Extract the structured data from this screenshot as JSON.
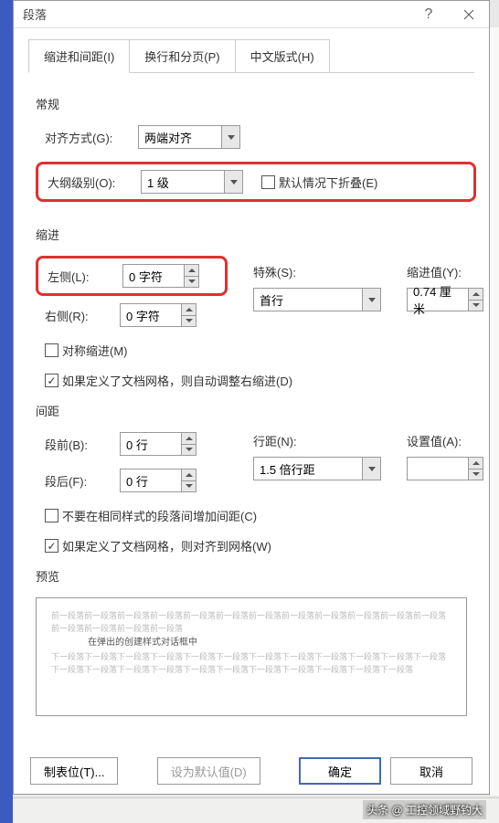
{
  "title": "段落",
  "tabs": [
    {
      "label": "缩进和间距(I)"
    },
    {
      "label": "换行和分页(P)"
    },
    {
      "label": "中文版式(H)"
    }
  ],
  "general": {
    "heading": "常规",
    "alignment_label": "对齐方式(G):",
    "alignment_value": "两端对齐",
    "outline_label": "大纲级别(O):",
    "outline_value": "1 级",
    "collapse_label": "默认情况下折叠(E)"
  },
  "indent": {
    "heading": "缩进",
    "left_label": "左侧(L):",
    "left_value": "0 字符",
    "right_label": "右侧(R):",
    "right_value": "0 字符",
    "special_label": "特殊(S):",
    "special_value": "首行",
    "by_label": "缩进值(Y):",
    "by_value": "0.74 厘米",
    "mirror_label": "对称缩进(M)",
    "grid_label": "如果定义了文档网格，则自动调整右缩进(D)"
  },
  "spacing": {
    "heading": "间距",
    "before_label": "段前(B):",
    "before_value": "0 行",
    "after_label": "段后(F):",
    "after_value": "0 行",
    "linespace_label": "行距(N):",
    "linespace_value": "1.5 倍行距",
    "at_label": "设置值(A):",
    "at_value": "",
    "nospace_label": "不要在相同样式的段落间增加间距(C)",
    "snap_label": "如果定义了文档网格，则对齐到网格(W)"
  },
  "preview": {
    "heading": "预览",
    "before_text": "前一段落前一段落前一段落前一段落前一段落前一段落前一段落前一段落前一段落前一段落前一段落前一段落前一段落前一段落前一段落前一段落",
    "sample_text": "在弹出的创建样式对话框中",
    "after_text": "下一段落下一段落下一段落下一段落下一段落下一段落下一段落下一段落下一段落下一段落下一段落下一段落下一段落下一段落下一段落下一段落下一段落下一段落下一段落下一段落下一段落下一段落下一段落"
  },
  "buttons": {
    "tabs": "制表位(T)...",
    "setdefault": "设为默认值(D)",
    "ok": "确定",
    "cancel": "取消"
  },
  "watermark": "头条 @ 工控领域野钓大"
}
